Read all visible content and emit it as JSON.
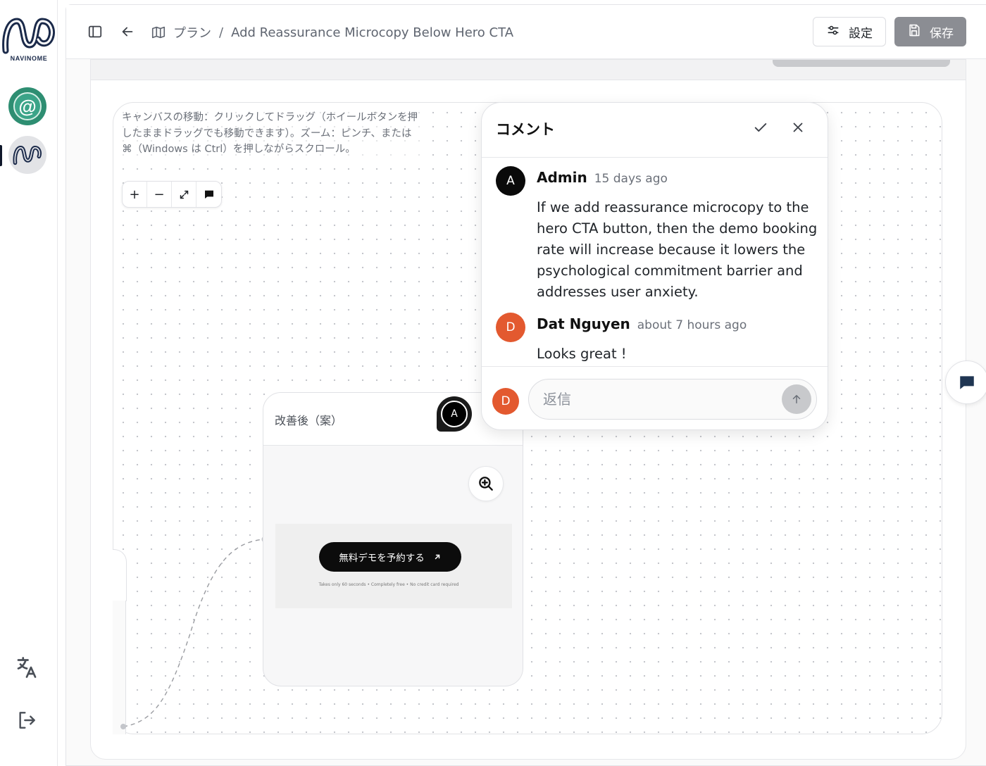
{
  "sidebar": {
    "logo_text": "NAVINOME",
    "apps": [
      {
        "icon": "at-sign-icon",
        "label": "@"
      },
      {
        "icon": "navinome-app-icon"
      }
    ],
    "bottom_icons": [
      "translate-icon",
      "logout-icon"
    ]
  },
  "topbar": {
    "breadcrumb_root": "プラン",
    "breadcrumb_separator": "/",
    "breadcrumb_current": "Add Reassurance Microcopy Below Hero CTA",
    "settings_label": "設定",
    "save_label": "保存"
  },
  "canvas": {
    "help_text": "キャンバスの移動：クリックしてドラッグ（ホイールボタンを押したままドラッグでも移動できます）。ズーム：ピンチ、または ⌘（Windows は Ctrl）を押しながらスクロール。",
    "zoom_controls": {
      "zoom_in": "+",
      "zoom_out": "−"
    }
  },
  "node": {
    "title": "改善後（案）",
    "avatar_initial": "A",
    "cta_label": "無料デモを予約する",
    "cta_subtext": "Takes only 60 seconds • Completely free • No credit card required"
  },
  "comments_panel": {
    "title": "コメント",
    "comments": [
      {
        "initial": "A",
        "author": "Admin",
        "time": "15 days ago",
        "body": "If we add reassurance microcopy to the hero CTA button, then the demo booking rate will increase because it lowers the psychological commitment barrier and addresses user anxiety.",
        "avatar_color": "#0a0a0a"
      },
      {
        "initial": "D",
        "author": "Dat Nguyen",
        "time": "about 7 hours ago",
        "body": "Looks great !",
        "avatar_color": "#e3592f"
      }
    ],
    "reply_avatar_initial": "D",
    "reply_placeholder": "返信",
    "reply_value": ""
  },
  "colors": {
    "accent_orange": "#e3592f",
    "save_button_bg": "#8b8d93",
    "brand_green": "#2e8e72",
    "brand_navy": "#1b2a4a"
  }
}
